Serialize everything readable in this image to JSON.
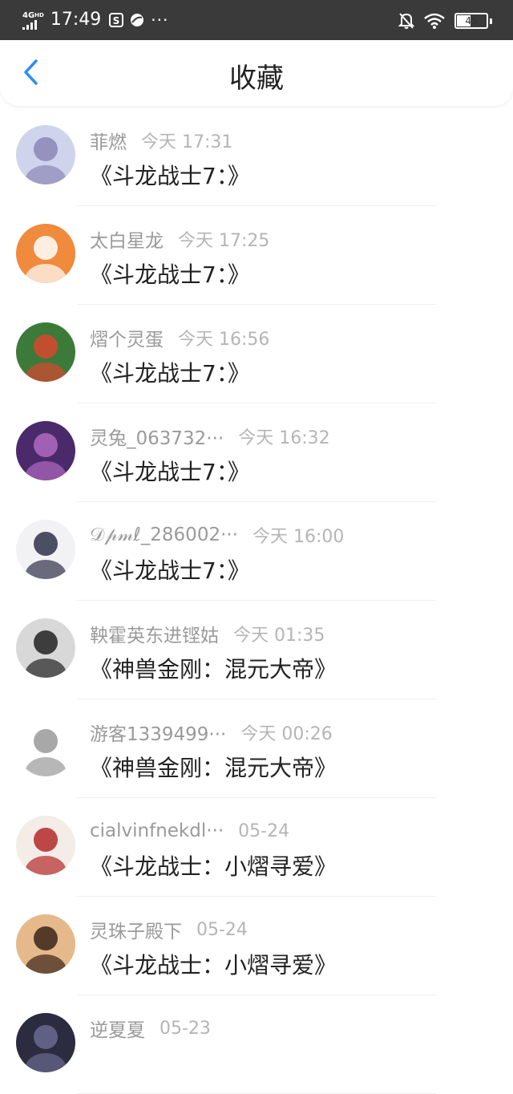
{
  "status_bar": {
    "network_label": "4G",
    "network_sup": "HD",
    "time": "17:49",
    "more": "···",
    "battery_level": "45",
    "icons": [
      "signal-icon",
      "app-s-icon",
      "app-leaf-icon",
      "mute-bell-icon",
      "wifi-icon",
      "battery-icon"
    ]
  },
  "nav": {
    "title": "收藏",
    "back_icon": "chevron-left-icon",
    "accent_color": "#2f8ef0"
  },
  "items": [
    {
      "user": "菲燃",
      "time": "今天 17:31",
      "title": "《斗龙战士7：》",
      "avatar_colors": [
        "#cfd4ec",
        "#8b86b8"
      ]
    },
    {
      "user": "太白星龙",
      "time": "今天 17:25",
      "title": "《斗龙战士7：》",
      "avatar_colors": [
        "#f08a3c",
        "#ffffff"
      ]
    },
    {
      "user": "熠个灵蛋",
      "time": "今天 16:56",
      "title": "《斗龙战士7：》",
      "avatar_colors": [
        "#3c7a3a",
        "#d9472f"
      ]
    },
    {
      "user": "灵兔_063732···",
      "time": "今天 16:32",
      "title": "《斗龙战士7：》",
      "avatar_colors": [
        "#4a2a6a",
        "#b06ac0"
      ]
    },
    {
      "user": "𝒟𝓅𝓂ℓ_286002···",
      "time": "今天 16:00",
      "title": "《斗龙战士7：》",
      "avatar_colors": [
        "#f2f2f4",
        "#30304a"
      ]
    },
    {
      "user": "鞅霍英东进铿姑",
      "time": "今天 01:35",
      "title": "《神兽金刚：混元大帝》",
      "avatar_colors": [
        "#d8d8d8",
        "#222222"
      ]
    },
    {
      "user": "游客1339499···",
      "time": "今天 00:26",
      "title": "《神兽金刚：混元大帝》",
      "avatar_colors": [
        "#ffffff",
        "#999999"
      ]
    },
    {
      "user": "cialvinfnekdl···",
      "time": "05-24",
      "title": "《斗龙战士：小熠寻爱》",
      "avatar_colors": [
        "#f4ece6",
        "#b32a2a"
      ]
    },
    {
      "user": "灵珠子殿下",
      "time": "05-24",
      "title": "《斗龙战士：小熠寻爱》",
      "avatar_colors": [
        "#e6b98a",
        "#3a2418"
      ]
    },
    {
      "user": "逆夏夏",
      "time": "05-23",
      "title": "",
      "avatar_colors": [
        "#2c2c40",
        "#6a6a90"
      ]
    }
  ]
}
